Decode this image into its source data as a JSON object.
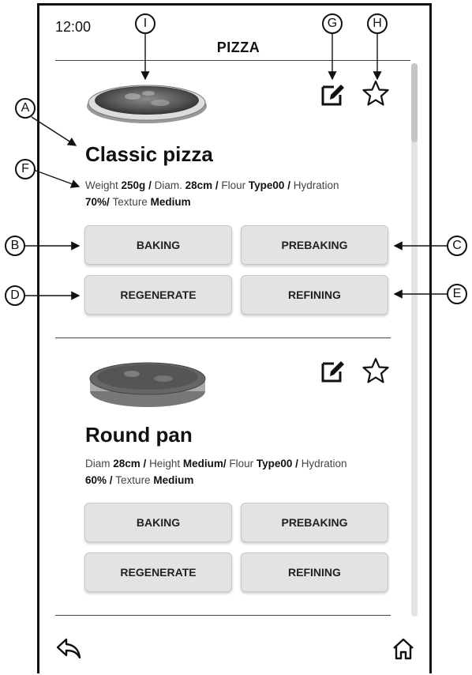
{
  "status": {
    "time": "12:00"
  },
  "header": {
    "title": "PIZZA"
  },
  "recipes": [
    {
      "name": "Classic pizza",
      "specs": [
        {
          "label": "Weight ",
          "value": "250g",
          "sep": " / "
        },
        {
          "label": "Diam. ",
          "value": "28cm",
          "sep": " / "
        },
        {
          "label": "Flour ",
          "value": "Type00",
          "sep": " / "
        },
        {
          "label": "Hydration ",
          "value": "70%",
          "sep": "/ "
        },
        {
          "label": "Texture ",
          "value": "Medium",
          "sep": ""
        }
      ],
      "buttons": [
        "BAKING",
        "PREBAKING",
        "REGENERATE",
        "REFINING"
      ]
    },
    {
      "name": "Round pan",
      "specs": [
        {
          "label": "Diam ",
          "value": "28cm",
          "sep": " / "
        },
        {
          "label": "Height ",
          "value": "Medium",
          "sep": "/ "
        },
        {
          "label": "Flour ",
          "value": "Type00",
          "sep": " / "
        },
        {
          "label": "Hydration ",
          "value": "60%",
          "sep": " / "
        },
        {
          "label": "Texture ",
          "value": "Medium",
          "sep": ""
        }
      ],
      "buttons": [
        "BAKING",
        "PREBAKING",
        "REGENERATE",
        "REFINING"
      ]
    }
  ],
  "callouts": [
    "A",
    "B",
    "C",
    "D",
    "E",
    "F",
    "G",
    "H",
    "I"
  ],
  "icons": {
    "edit": "edit-icon",
    "favorite": "star-icon",
    "back": "back-arrow-icon",
    "home": "home-icon"
  }
}
